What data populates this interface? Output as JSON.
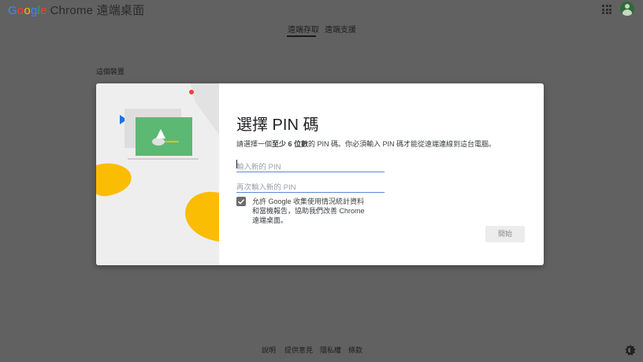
{
  "header": {
    "brand_google": "Google",
    "brand_rest": "Chrome 遠端桌面",
    "google_colors": [
      "#4285F4",
      "#EA4335",
      "#FBBC05",
      "#4285F4",
      "#34A853",
      "#EA4335"
    ],
    "apps_icon": "apps-grid-icon",
    "avatar_icon": "user-avatar"
  },
  "tabs": [
    {
      "label": "遠端存取",
      "active": true
    },
    {
      "label": "遠端支援",
      "active": false
    }
  ],
  "section_title": "這個裝置",
  "dialog": {
    "title": "選擇 PIN 碼",
    "desc_before": "請選擇一個",
    "desc_bold": "至少 6 位數",
    "desc_after": "的 PIN 碼。你必須輸入 PIN 碼才能從遠端連線到這台電腦。",
    "pin_placeholder": "輸入新的 PIN",
    "pin_confirm_placeholder": "再次輸入新的 PIN",
    "pin_value": "",
    "pin_confirm_value": "",
    "consent_checked": true,
    "consent_text": "允許 Google 收集使用情況統計資料和當機報告，協助我們改善 Chrome 遠端桌面。",
    "start_label": "開始",
    "start_enabled": false
  },
  "footer": {
    "links": [
      "說明",
      "提供意見",
      "隱私權",
      "條款"
    ],
    "theme_icon": "theme-toggle-icon"
  },
  "colors": {
    "page_bg": "#616161",
    "accent_blue": "#5b8ad6",
    "art_green": "#5bb974",
    "art_yellow": "#fbbc04",
    "art_red": "#ea4335",
    "art_blue": "#1a73e8"
  }
}
